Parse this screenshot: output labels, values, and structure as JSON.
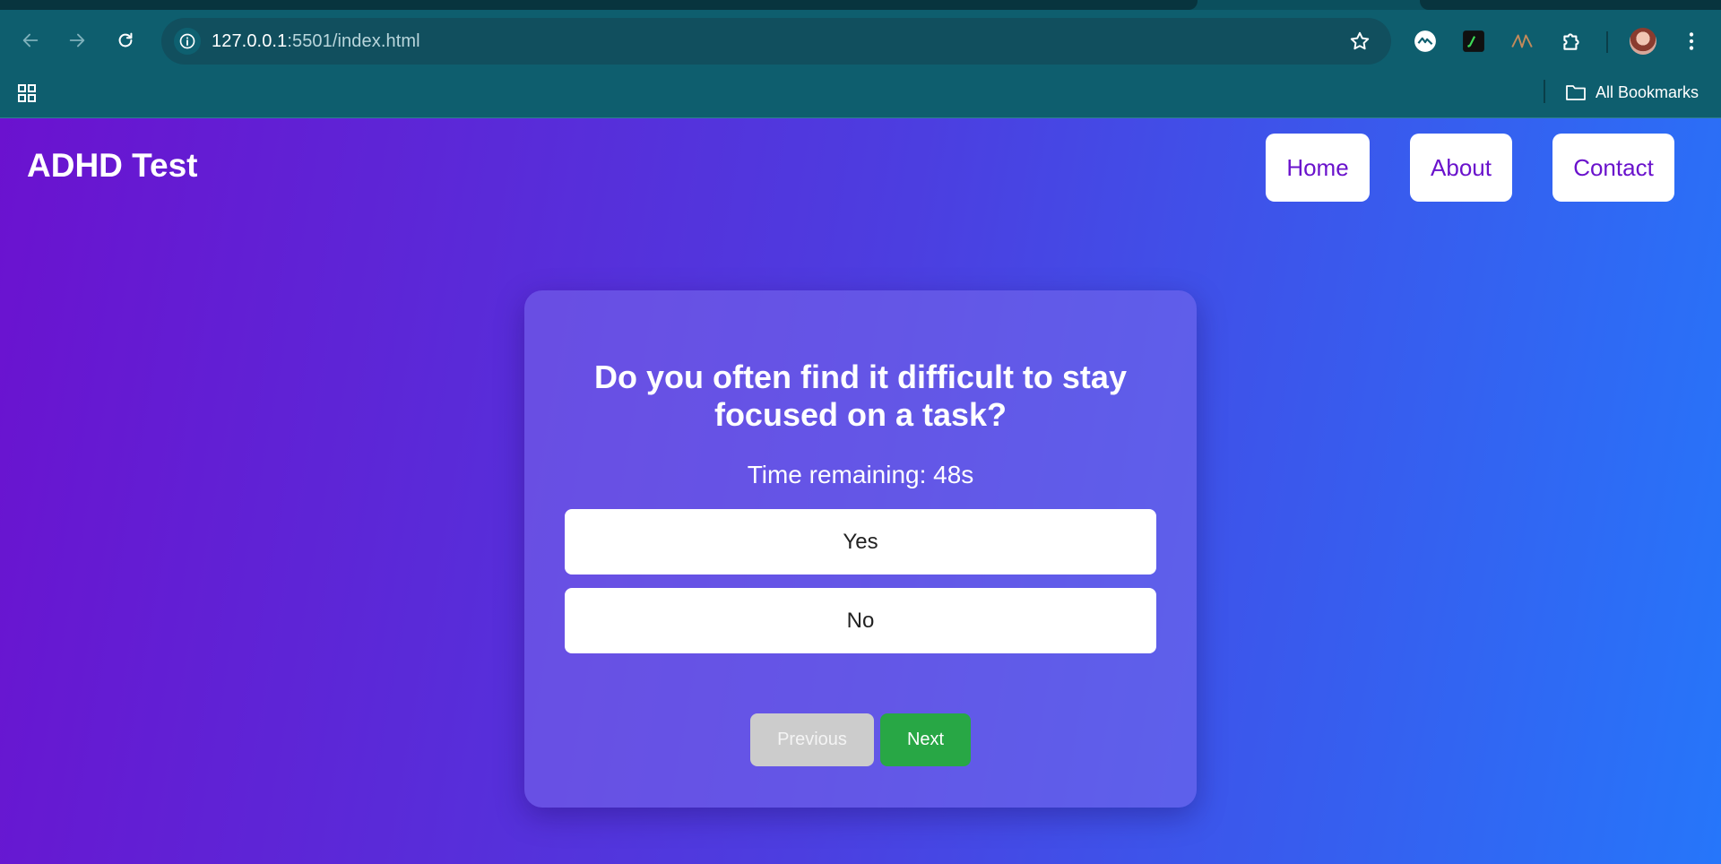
{
  "browser": {
    "url_host": "127.0.0.1",
    "url_path": ":5501/index.html",
    "bookmarks_label": "All Bookmarks",
    "icons": [
      "back-icon",
      "forward-icon",
      "reload-icon",
      "info-icon",
      "star-icon",
      "extension-icon",
      "puzzle-icon",
      "profile-avatar",
      "more-vert-icon",
      "apps-grid-icon",
      "folder-icon"
    ]
  },
  "header": {
    "brand": "ADHD Test",
    "nav": {
      "home": "Home",
      "about": "About",
      "contact": "Contact"
    }
  },
  "quiz": {
    "question": "Do you often find it difficult to stay focused on a task?",
    "timer": "Time remaining: 48s",
    "options": [
      "Yes",
      "No"
    ],
    "previous_label": "Previous",
    "next_label": "Next"
  },
  "colors": {
    "gradient_start": "#6b12cf",
    "gradient_end": "#2676fa",
    "nav_text": "#6a12cc",
    "next_button": "#28a745",
    "previous_button": "#cccccc",
    "chrome": "#0e5e6e"
  }
}
